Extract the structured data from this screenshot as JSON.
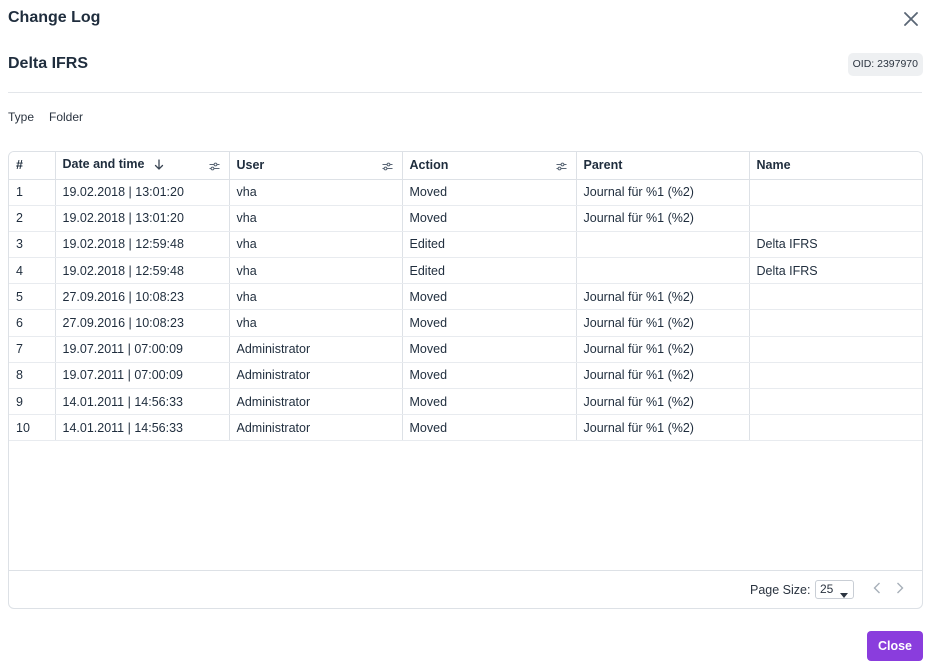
{
  "dialog": {
    "title": "Change Log",
    "object_name": "Delta IFRS",
    "oid": "OID: 2397970",
    "type_label": "Type",
    "type_value": "Folder",
    "close_label": "Close"
  },
  "table": {
    "columns": [
      "#",
      "Date and time",
      "User",
      "Action",
      "Parent",
      "Name"
    ],
    "rows": [
      [
        "1",
        "19.02.2018 | 13:01:20",
        "vha",
        "Moved",
        "Journal für %1 (%2)",
        ""
      ],
      [
        "2",
        "19.02.2018 | 13:01:20",
        "vha",
        "Moved",
        "Journal für %1 (%2)",
        ""
      ],
      [
        "3",
        "19.02.2018 | 12:59:48",
        "vha",
        "Edited",
        "",
        "Delta IFRS"
      ],
      [
        "4",
        "19.02.2018 | 12:59:48",
        "vha",
        "Edited",
        "",
        "Delta IFRS"
      ],
      [
        "5",
        "27.09.2016 | 10:08:23",
        "vha",
        "Moved",
        "Journal für %1 (%2)",
        ""
      ],
      [
        "6",
        "27.09.2016 | 10:08:23",
        "vha",
        "Moved",
        "Journal für %1 (%2)",
        ""
      ],
      [
        "7",
        "19.07.2011 | 07:00:09",
        "Administrator",
        "Moved",
        "Journal für %1 (%2)",
        ""
      ],
      [
        "8",
        "19.07.2011 | 07:00:09",
        "Administrator",
        "Moved",
        "Journal für %1 (%2)",
        ""
      ],
      [
        "9",
        "14.01.2011 | 14:56:33",
        "Administrator",
        "Moved",
        "Journal für %1 (%2)",
        ""
      ],
      [
        "10",
        "14.01.2011 | 14:56:33",
        "Administrator",
        "Moved",
        "Journal für %1 (%2)",
        ""
      ]
    ]
  },
  "pagination": {
    "page_size_label": "Page Size:",
    "page_size_value": "25"
  },
  "colors": {
    "accent": "#8a3ddd",
    "text": "#1f2d3d",
    "border": "#dde1e6"
  }
}
